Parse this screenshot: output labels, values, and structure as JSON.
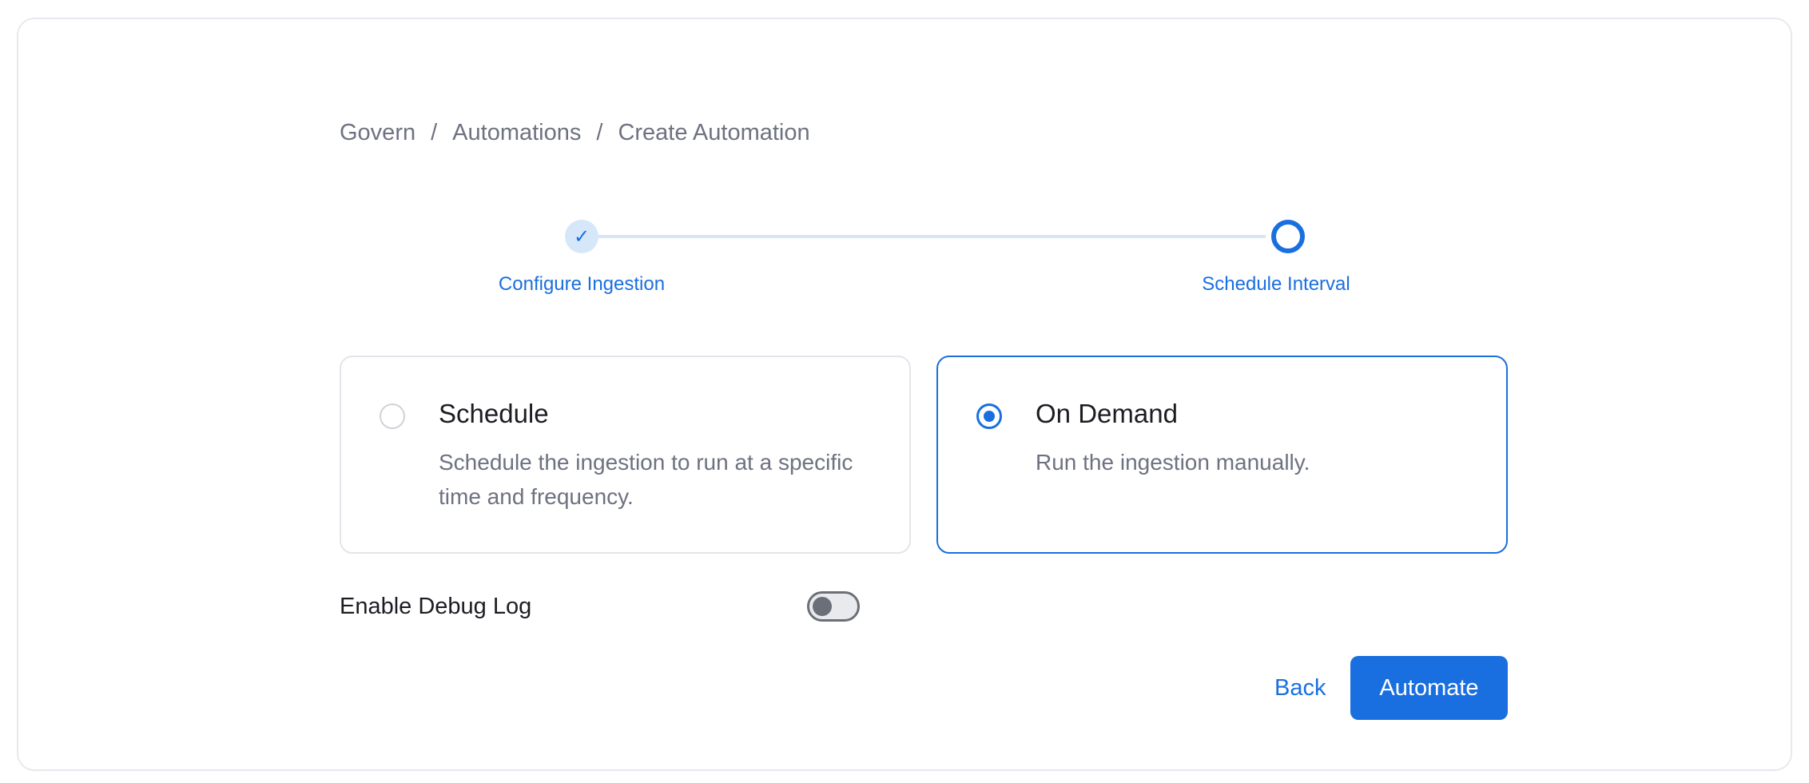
{
  "breadcrumb": {
    "items": [
      "Govern",
      "Automations",
      "Create Automation"
    ],
    "separator": "/"
  },
  "stepper": {
    "steps": [
      {
        "label": "Configure Ingestion",
        "status": "completed",
        "icon": "check-icon"
      },
      {
        "label": "Schedule Interval",
        "status": "active"
      }
    ]
  },
  "options": [
    {
      "title": "Schedule",
      "description": "Schedule the ingestion to run at a specific time and frequency.",
      "selected": false
    },
    {
      "title": "On Demand",
      "description": "Run the ingestion manually.",
      "selected": true
    }
  ],
  "debug": {
    "label": "Enable Debug Log",
    "enabled": false
  },
  "actions": {
    "back_label": "Back",
    "automate_label": "Automate"
  },
  "colors": {
    "accent": "#1a6fe0",
    "muted_text": "#6e7280",
    "border": "#e3e5ea"
  }
}
